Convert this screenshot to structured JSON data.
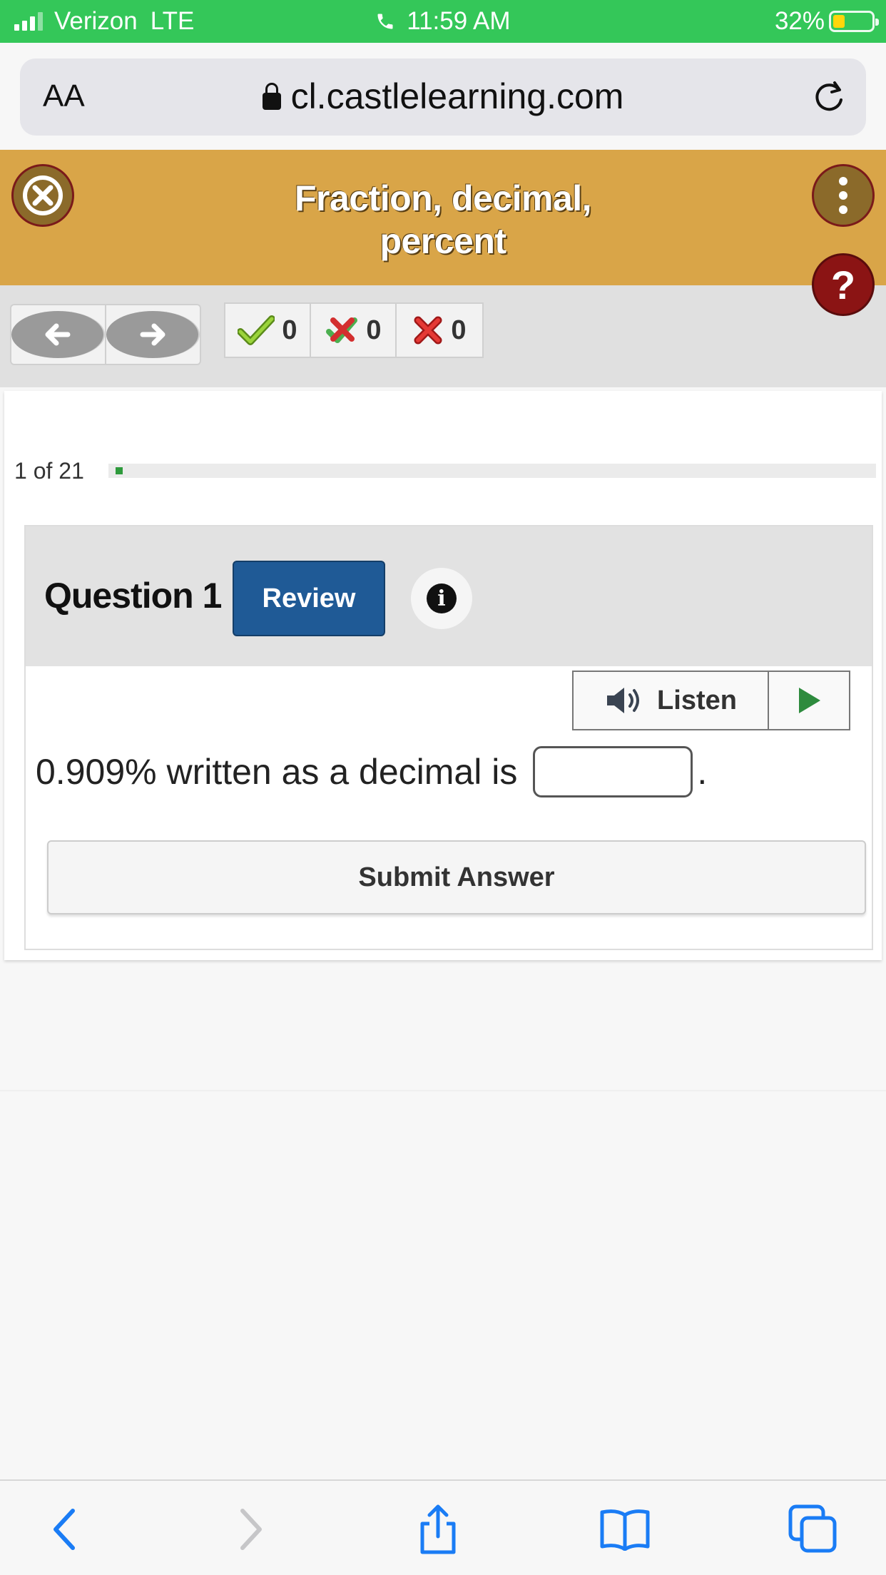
{
  "status_bar": {
    "carrier": "Verizon",
    "network": "LTE",
    "time": "11:59 AM",
    "battery": "32%",
    "battery_level": 0.32
  },
  "browser": {
    "text_size_label": "AA",
    "url": "cl.castlelearning.com"
  },
  "header": {
    "title_line1": "Fraction, decimal,",
    "title_line2": "percent",
    "help_label": "?"
  },
  "scores": {
    "correct": "0",
    "partial": "0",
    "incorrect": "0"
  },
  "progress": {
    "label": "1 of 21",
    "current": 1,
    "total": 21
  },
  "question": {
    "title": "Question 1",
    "review_label": "Review",
    "info_label": "i",
    "listen_label": "Listen",
    "text_before": "0.909% written as a decimal is",
    "text_after": ".",
    "answer_value": "",
    "submit_label": "Submit Answer"
  },
  "colors": {
    "status_green": "#34c759",
    "header_gold": "#d9a548",
    "review_blue": "#1f5a96",
    "progress_green": "#2e9a3c",
    "help_red": "#8b1414"
  },
  "icons": {
    "close": "close-icon",
    "menu": "more-vertical-icon",
    "help": "question-icon",
    "back": "arrow-left-icon",
    "forward": "arrow-right-icon",
    "correct": "checkmark-icon",
    "partial": "partial-icon",
    "incorrect": "x-icon",
    "listen": "speaker-icon",
    "play": "play-icon"
  }
}
